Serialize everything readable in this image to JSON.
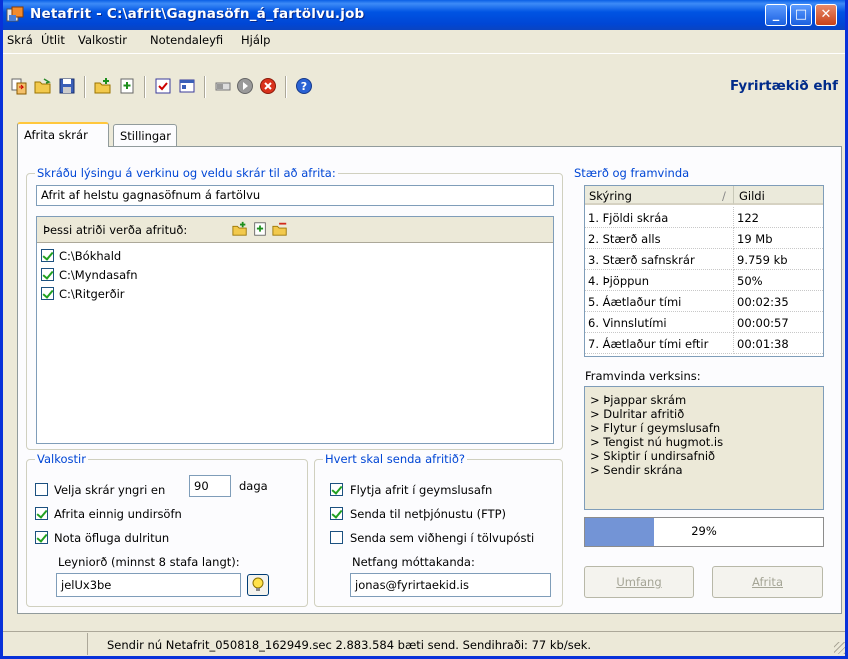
{
  "window": {
    "title": "Netafrit - C:\\afrit\\Gagnasöfn_á_fartölvu.job",
    "minimize": "_",
    "maximize": "□",
    "close": "✕"
  },
  "menu": [
    "Skrá",
    "Útlit",
    "Valkostir",
    "Notendaleyfi",
    "Hjálp"
  ],
  "toolbar": {
    "icons": [
      "copy-to-icon",
      "open-folder-icon",
      "save-icon",
      "add-folder-icon",
      "add-file-icon",
      "checklist-icon",
      "properties-icon",
      "progress-icon",
      "run-icon",
      "stop-icon",
      "help-icon"
    ],
    "company": "Fyrirtækið ehf"
  },
  "tabs": [
    "Afrita skrár",
    "Stillingar"
  ],
  "description_group": {
    "legend": "Skráðu lýsingu á verkinu og veldu skrár til að afrita:",
    "description_value": "Afrit af helstu gagnasöfnum á fartölvu",
    "list_header": "Þessi atriði verða afrituð:",
    "items": [
      {
        "label": "C:\\Bókhald",
        "checked": true
      },
      {
        "label": "C:\\Myndasafn",
        "checked": true
      },
      {
        "label": "C:\\Ritgerðir",
        "checked": true
      }
    ]
  },
  "options_group": {
    "legend": "Valkostir",
    "younger_label": "Velja skrár yngri en",
    "younger_checked": false,
    "days_value": "90",
    "days_unit": "daga",
    "subfolders_label": "Afrita einnig undirsöfn",
    "subfolders_checked": true,
    "encryption_label": "Nota öfluga dulritun",
    "encryption_checked": true,
    "password_label": "Leyniorð (minnst 8 stafa langt):",
    "password_value": "jelUx3be"
  },
  "destination_group": {
    "legend": "Hvert skal senda afritið?",
    "archive_label": "Flytja afrit í geymslusafn",
    "archive_checked": true,
    "ftp_label": "Senda til netþjónustu (FTP)",
    "ftp_checked": true,
    "email_label": "Senda sem viðhengi í tölvupósti",
    "email_checked": false,
    "recipient_label": "Netfang móttakanda:",
    "recipient_value": "jonas@fyrirtaekid.is"
  },
  "stats_group": {
    "legend": "Stærð og framvinda",
    "columns": [
      "Skýring",
      "Gildi"
    ],
    "sort_indicator": "/",
    "rows": [
      {
        "label": "1. Fjöldi skráa",
        "value": "122"
      },
      {
        "label": "2. Stærð alls",
        "value": "19 Mb"
      },
      {
        "label": "3. Stærð safnskrár",
        "value": "9.759 kb"
      },
      {
        "label": "4. Þjöppun",
        "value": "50%"
      },
      {
        "label": "5. Áætlaður tími",
        "value": "00:02:35"
      },
      {
        "label": "6. Vinnslutími",
        "value": "00:00:57"
      },
      {
        "label": "7. Áætlaður tími eftir",
        "value": "00:01:38"
      }
    ],
    "progress_label": "Framvinda verksins:",
    "progress_lines": [
      "> Þjappar skrám",
      "> Dulritar afritið",
      "> Flytur í geymslusafn",
      "> Tengist nú hugmot.is",
      "> Skiptir í undirsafnið",
      "> Sendir skrána"
    ],
    "progress_percent": 29,
    "progress_text": "29%",
    "scope_button": "Umfang",
    "backup_button": "Afrita"
  },
  "status": "Sendir nú Netafrit_050818_162949.sec  2.883.584 bæti send.  Sendihraði: 77 kb/sek."
}
